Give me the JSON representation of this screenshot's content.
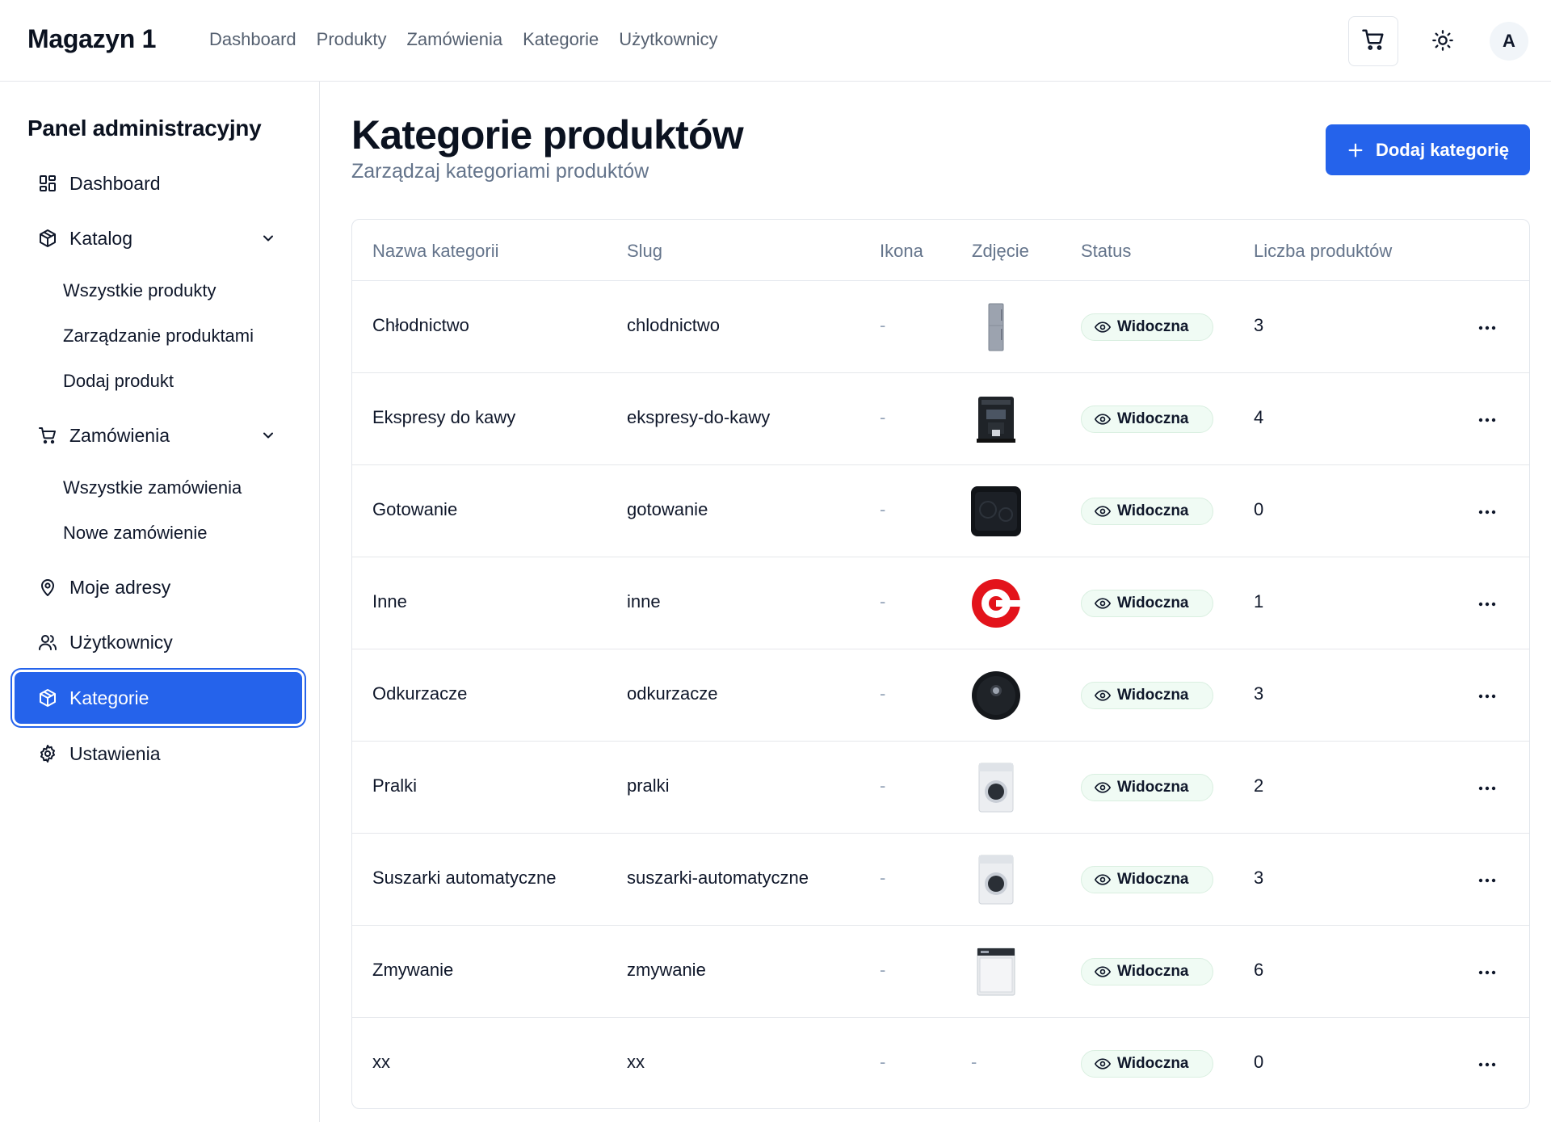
{
  "topbar": {
    "brand": "Magazyn 1",
    "nav": [
      "Dashboard",
      "Produkty",
      "Zamówienia",
      "Kategorie",
      "Użytkownicy"
    ],
    "avatar_initial": "A"
  },
  "sidebar": {
    "title": "Panel administracyjny",
    "dashboard": "Dashboard",
    "katalog": "Katalog",
    "katalog_sub": [
      "Wszystkie produkty",
      "Zarządzanie produktami",
      "Dodaj produkt"
    ],
    "zamowienia": "Zamówienia",
    "zamowienia_sub": [
      "Wszystkie zamówienia",
      "Nowe zamówienie"
    ],
    "adresy": "Moje adresy",
    "uzytkownicy": "Użytkownicy",
    "kategorie": "Kategorie",
    "ustawienia": "Ustawienia"
  },
  "main": {
    "title": "Kategorie produktów",
    "subtitle": "Zarządzaj kategoriami produktów",
    "add_button": "Dodaj kategorię",
    "accent_color": "#2563eb"
  },
  "table": {
    "headers": {
      "name": "Nazwa kategorii",
      "slug": "Slug",
      "icon": "Ikona",
      "image": "Zdjęcie",
      "status": "Status",
      "count": "Liczba produktów"
    },
    "rows": [
      {
        "name": "Chłodnictwo",
        "slug": "chlodnictwo",
        "icon": "-",
        "image": "fridge-image",
        "image_text": "",
        "status": "Widoczna",
        "count": "3"
      },
      {
        "name": "Ekspresy do kawy",
        "slug": "ekspresy-do-kawy",
        "icon": "-",
        "image": "coffee-machine-image",
        "image_text": "",
        "status": "Widoczna",
        "count": "4"
      },
      {
        "name": "Gotowanie",
        "slug": "gotowanie",
        "icon": "-",
        "image": "cooktop-image",
        "image_text": "",
        "status": "Widoczna",
        "count": "0"
      },
      {
        "name": "Inne",
        "slug": "inne",
        "icon": "-",
        "image": "red-logo-image",
        "image_text": "",
        "status": "Widoczna",
        "count": "1"
      },
      {
        "name": "Odkurzacze",
        "slug": "odkurzacze",
        "icon": "-",
        "image": "robot-vacuum-image",
        "image_text": "",
        "status": "Widoczna",
        "count": "3"
      },
      {
        "name": "Pralki",
        "slug": "pralki",
        "icon": "-",
        "image": "washing-machine-image",
        "image_text": "",
        "status": "Widoczna",
        "count": "2"
      },
      {
        "name": "Suszarki automatyczne",
        "slug": "suszarki-automatyczne",
        "icon": "-",
        "image": "dryer-image",
        "image_text": "",
        "status": "Widoczna",
        "count": "3"
      },
      {
        "name": "Zmywanie",
        "slug": "zmywanie",
        "icon": "-",
        "image": "dishwasher-image",
        "image_text": "",
        "status": "Widoczna",
        "count": "6"
      },
      {
        "name": "xx",
        "slug": "xx",
        "icon": "-",
        "image": "none",
        "image_text": "-",
        "status": "Widoczna",
        "count": "0"
      }
    ]
  }
}
